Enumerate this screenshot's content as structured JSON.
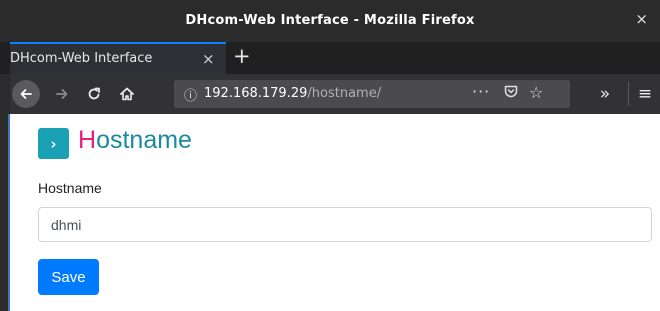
{
  "window": {
    "title": "DHcom-Web Interface - Mozilla Firefox",
    "close_glyph": "×"
  },
  "tabs": [
    {
      "label": "DHcom-Web Interface",
      "close_glyph": "×",
      "active": true
    }
  ],
  "new_tab_glyph": "+",
  "navbar": {
    "back_icon": "back-arrow-icon",
    "forward_icon": "forward-arrow-icon",
    "reload_icon": "reload-icon",
    "home_icon": "home-icon",
    "url_host": "192.168.179.29",
    "url_path": "/hostname/",
    "overflow_glyph": "»",
    "menu_glyph": "≡",
    "page_actions_glyph": "···"
  },
  "page": {
    "heading_icon_glyph": "›",
    "heading_first_letter": "H",
    "heading_rest": "ostname",
    "hostname_label": "Hostname",
    "hostname_value": "dhmi",
    "save_label": "Save"
  },
  "colors": {
    "accent_blue": "#007bff",
    "heading_teal": "#1b8a9d",
    "heading_pink": "#e2217d",
    "icon_teal": "#1aa1b6"
  }
}
